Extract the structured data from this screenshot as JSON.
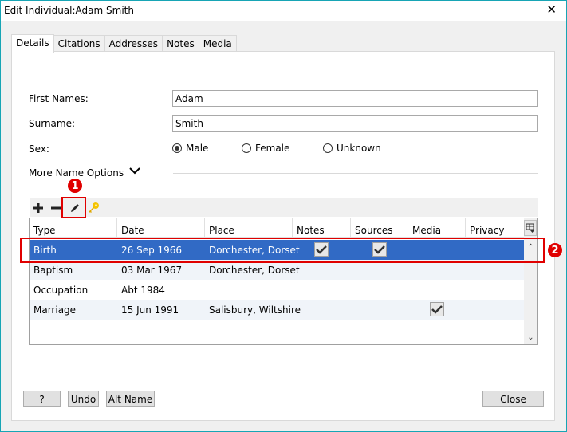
{
  "window": {
    "title": "Edit Individual:Adam Smith",
    "close_icon": "close-x-icon"
  },
  "tabs": [
    {
      "label": "Details",
      "active": true
    },
    {
      "label": "Citations"
    },
    {
      "label": "Addresses"
    },
    {
      "label": "Notes"
    },
    {
      "label": "Media"
    }
  ],
  "form": {
    "first_names_label": "First Names:",
    "first_names_value": "Adam",
    "surname_label": "Surname:",
    "surname_value": "Smith",
    "sex_label": "Sex:",
    "sex_options": [
      {
        "label": "Male",
        "selected": true
      },
      {
        "label": "Female",
        "selected": false
      },
      {
        "label": "Unknown",
        "selected": false
      }
    ],
    "more_options_label": "More Name Options"
  },
  "toolbar": {
    "add_icon": "plus-icon",
    "remove_icon": "minus-icon",
    "edit_icon": "pencil-icon",
    "privacy_icon": "key-icon"
  },
  "annotations": {
    "badge1": "1",
    "badge2": "2",
    "color": "#e00000"
  },
  "events": {
    "columns": [
      "Type",
      "Date",
      "Place",
      "Notes",
      "Sources",
      "Media",
      "Privacy"
    ],
    "rows": [
      {
        "type": "Birth",
        "date": "26 Sep 1966",
        "place": "Dorchester, Dorset",
        "notes": true,
        "sources": true,
        "media": false,
        "selected": true
      },
      {
        "type": "Baptism",
        "date": "03 Mar 1967",
        "place": "Dorchester, Dorset",
        "notes": false,
        "sources": false,
        "media": false
      },
      {
        "type": "Occupation",
        "date": "Abt 1984",
        "place": "",
        "notes": false,
        "sources": false,
        "media": false
      },
      {
        "type": "Marriage",
        "date": "15 Jun 1991",
        "place": "Salisbury, Wiltshire",
        "notes": false,
        "sources": false,
        "media": true
      }
    ],
    "selection_color": "#316ac5"
  },
  "buttons": {
    "help": "?",
    "undo": "Undo",
    "alt_name": "Alt Name",
    "close": "Close"
  }
}
